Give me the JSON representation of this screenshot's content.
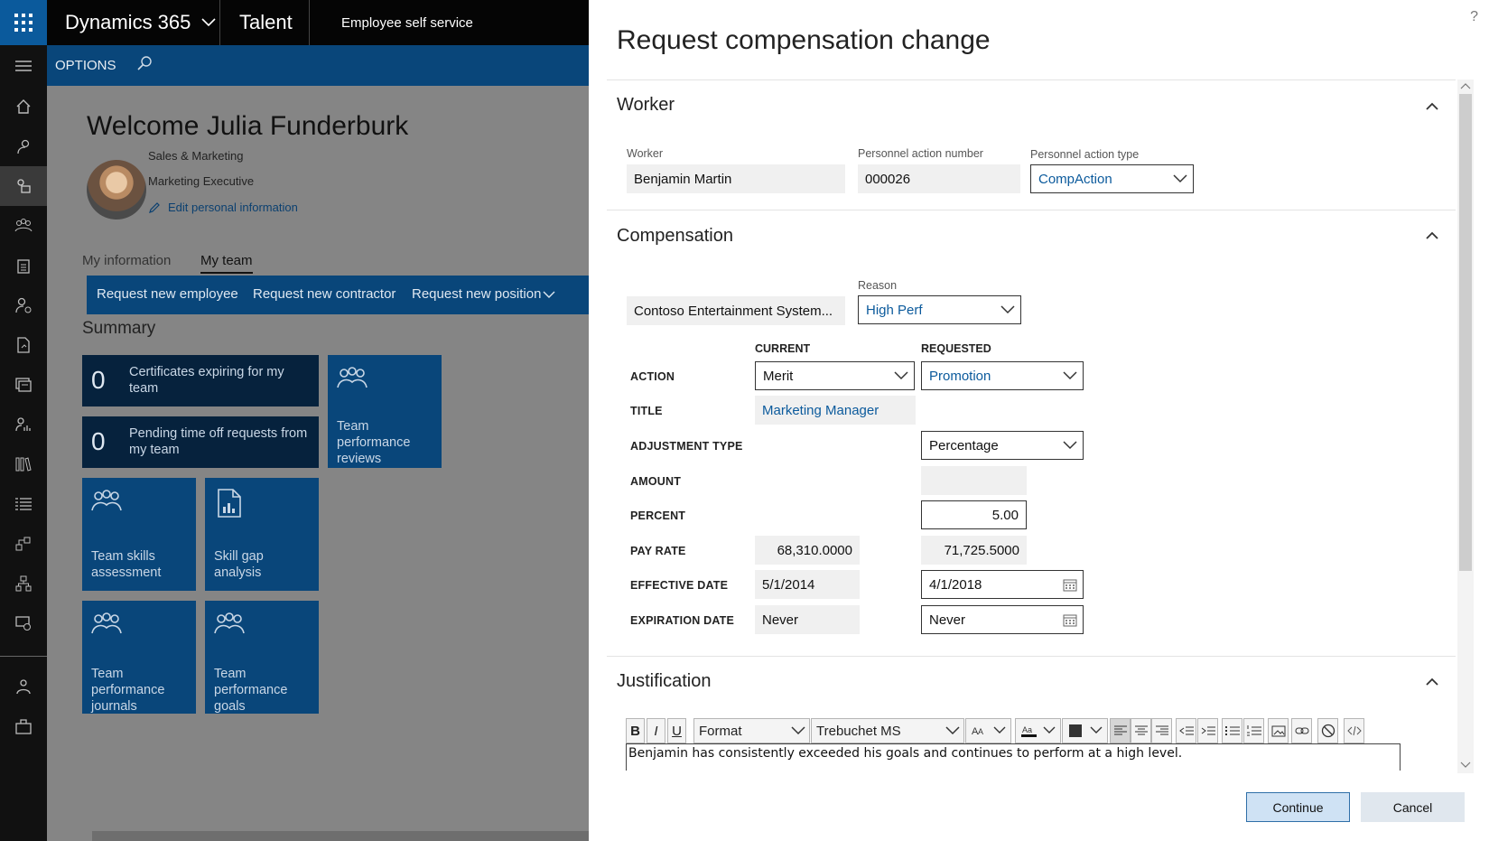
{
  "app": {
    "product": "Dynamics 365",
    "module": "Talent",
    "area": "Employee self service",
    "options_label": "OPTIONS"
  },
  "nav_rail": {
    "icons": [
      "home-icon",
      "people-icon",
      "worker-icon",
      "team-icon",
      "clipboard-icon",
      "person-gear-icon",
      "document-icon",
      "training-icon",
      "person-chart-icon",
      "library-icon",
      "list-icon",
      "workflow-icon",
      "org-icon",
      "feedback-icon",
      "group-icon",
      "benefits-icon"
    ],
    "active_index": 2
  },
  "workspace": {
    "welcome": "Welcome Julia Funderburk",
    "department": "Sales & Marketing",
    "job_title": "Marketing Executive",
    "edit_link": "Edit personal information",
    "tabs": [
      "My information",
      "My team"
    ],
    "selected_tab": "My team",
    "actions": [
      "Request new employee",
      "Request new contractor",
      "Request new position"
    ],
    "summary_title": "Summary",
    "tiles": [
      {
        "count": "0",
        "label": "Certificates expiring for my team"
      },
      {
        "count": "0",
        "label": "Pending time off requests from my team"
      },
      {
        "icon": "team-icon",
        "label": "Team performance reviews"
      },
      {
        "icon": "team-icon",
        "label": "Team skills assessment"
      },
      {
        "icon": "report-icon",
        "label": "Skill gap analysis"
      },
      {
        "icon": "team-icon",
        "label": "Team performance journals"
      },
      {
        "icon": "team-icon",
        "label": "Team performance goals"
      }
    ]
  },
  "dialog": {
    "title": "Request compensation change",
    "help": "?",
    "worker_section": {
      "title": "Worker",
      "worker_label": "Worker",
      "worker_value": "Benjamin Martin",
      "pa_number_label": "Personnel action number",
      "pa_number_value": "000026",
      "pa_type_label": "Personnel action type",
      "pa_type_value": "CompAction"
    },
    "compensation_section": {
      "title": "Compensation",
      "plan_value": "Contoso Entertainment System...",
      "reason_label": "Reason",
      "reason_value": "High Perf",
      "current_header": "CURRENT",
      "requested_header": "REQUESTED",
      "rows": {
        "action": {
          "label": "ACTION",
          "current": "Merit",
          "requested": "Promotion"
        },
        "title": {
          "label": "TITLE",
          "current": "Marketing Manager"
        },
        "adjustment_type": {
          "label": "ADJUSTMENT TYPE",
          "requested": "Percentage"
        },
        "amount": {
          "label": "AMOUNT",
          "requested": ""
        },
        "percent": {
          "label": "PERCENT",
          "requested": "5.00"
        },
        "pay_rate": {
          "label": "PAY RATE",
          "current": "68,310.0000",
          "requested": "71,725.5000"
        },
        "effective_date": {
          "label": "EFFECTIVE DATE",
          "current": "5/1/2014",
          "requested": "4/1/2018"
        },
        "expiration_date": {
          "label": "EXPIRATION DATE",
          "current": "Never",
          "requested": "Never"
        }
      }
    },
    "justification_section": {
      "title": "Justification",
      "toolbar": {
        "bold": "B",
        "italic": "I",
        "underline": "U",
        "format": "Format",
        "font": "Trebuchet MS"
      },
      "text": "Benjamin has consistently exceeded his goals and continues to perform at a high level."
    },
    "buttons": {
      "continue": "Continue",
      "cancel": "Cancel"
    }
  }
}
